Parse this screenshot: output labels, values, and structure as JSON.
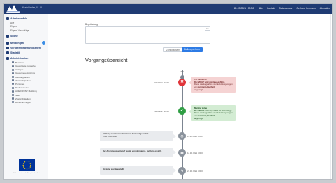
{
  "header": {
    "app_title": "Kreiskinder, UL U",
    "nav": [
      {
        "label": "21.09.2021 | 09:00"
      },
      {
        "label": "Hilfe"
      },
      {
        "label": "Kontakt"
      },
      {
        "label": "Datenschutz"
      },
      {
        "label": "Gerhard Hermann"
      },
      {
        "label": "Abmelden"
      }
    ]
  },
  "sidebar": {
    "group_1": {
      "label": "Arbeitsumfeld",
      "subs": [
        "Alle",
        "Eigene",
        "Eigene Vorschläge"
      ]
    },
    "items": [
      {
        "label": "Suche"
      },
      {
        "label": "Meldungen"
      },
      {
        "label": "Vorbereitungsfähigkeiten"
      },
      {
        "label": "Statistik"
      },
      {
        "label": "Administration"
      }
    ],
    "admin_subs": [
      "Benutzer",
      "Gewichtete Gewerbe",
      "Anlagen",
      "Gewerbeverzeichnis",
      "Meldungsarten",
      "Zuständigkeiten",
      "Personen",
      "Textbausteine",
      "ADE FRONT Meldung",
      "Sites",
      "Zuständigkeiten",
      "Benachrichtigen"
    ],
    "eu_caption": "Kofinanziert von der Europäischen Union"
  },
  "form": {
    "note_label": "Begründung",
    "mini_label": "Ue",
    "reset_label": "Zurücksetzen",
    "save_label": "Stellung nehmen"
  },
  "timeline": {
    "title": "Vorgangsübersicht",
    "year": "2021",
    "events": [
      {
        "time": "21.10.2021 10:00",
        "title": "Till Elbmarsh",
        "line1": "Der VRIG? wird nicht ausgeführt.",
        "line2": "Diese Stellungnahme wurde zurückgezogen von",
        "line2_b": "Hermann, Gerhard",
        "line3": "angezeigt.",
        "status": "rejected"
      },
      {
        "time": "21.10.2021 10:00",
        "title": "Martina Vetter",
        "line1": "Der VRIG? wird angeführt mit Ausstrags",
        "line2": "Diese Stellungnahme wurde zurückgezogen von",
        "line2_b": "Hermann, Gerhard",
        "line3": "angezeigt.",
        "status": "approved"
      },
      {
        "time": "11.10.2021 10:00",
        "title": "Stellung wurde von Hermanns, Gerhard geändert",
        "line1": "8 bis 16.08.2021",
        "status": "log"
      },
      {
        "time": "12.10.2021 10:00",
        "title": "Der Anordnungsentwurf wurde von Hermanns, Gerhard erstellt.",
        "line1": "",
        "status": "log"
      },
      {
        "time": "21.10.2021 10:00",
        "title": "Vorgang wurde erstellt.",
        "line1": "",
        "status": "log"
      }
    ]
  }
}
